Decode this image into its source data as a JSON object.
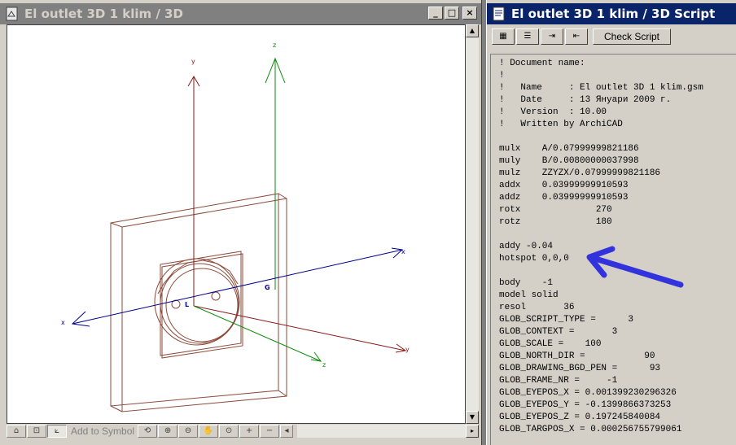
{
  "window_3d": {
    "title": "El outlet 3D 1 klim / 3D",
    "caption_buttons": [
      "_",
      "□",
      "×"
    ],
    "axis_labels": {
      "y_top": "y",
      "z_top": "z",
      "x_right": "x",
      "x_left": "x",
      "z_bottom": "z",
      "y_bottom": "y"
    },
    "point_labels": {
      "L": "L",
      "G": "G"
    },
    "bottom_toolbar": {
      "add_to_symbol": "Add to Symbol",
      "icons": [
        "home-icon",
        "zoom-fit-icon",
        "perspective-icon",
        "zoom-in-icon",
        "zoom-out-icon",
        "pan-hand-icon",
        "zoom-window-icon",
        "zoom-plus-icon",
        "zoom-minus-icon"
      ]
    },
    "colors": {
      "frame": "#8b4a3a",
      "y_axis": "#8b1a1a",
      "z_axis": "#0a8a0a",
      "x_axis": "#00008b"
    }
  },
  "window_script": {
    "title": "El outlet 3D 1 klim / 3D Script",
    "caption_buttons": [
      "×"
    ],
    "toolbar": {
      "check_script": "Check Script"
    },
    "lines": [
      "! Document name:",
      "!",
      "!   Name     : El outlet 3D 1 klim.gsm",
      "!   Date     : 13 Януари 2009 г.",
      "!   Version  : 10.00",
      "!   Written by ArchiCAD",
      "",
      "mulx    A/0.07999999821186",
      "muly    B/0.00800000037998",
      "mulz    ZZYZX/0.07999999821186",
      "addx    0.03999999910593",
      "addz    0.03999999910593",
      "rotx              270",
      "rotz              180",
      "",
      "addy -0.04",
      "hotspot 0,0,0",
      "",
      "body    -1",
      "model solid",
      "resol       36",
      "GLOB_SCRIPT_TYPE =      3",
      "GLOB_CONTEXT =       3",
      "GLOB_SCALE =    100",
      "GLOB_NORTH_DIR =           90",
      "GLOB_DRAWING_BGD_PEN =      93",
      "GLOB_FRAME_NR =     -1",
      "GLOB_EYEPOS_X = 0.001399230296326",
      "GLOB_EYEPOS_Y = -0.1399866373253",
      "GLOB_EYEPOS_Z = 0.197245840084",
      "GLOB_TARGPOS_X = 0.000256755799061"
    ],
    "annotation_color": "#3333dd"
  }
}
